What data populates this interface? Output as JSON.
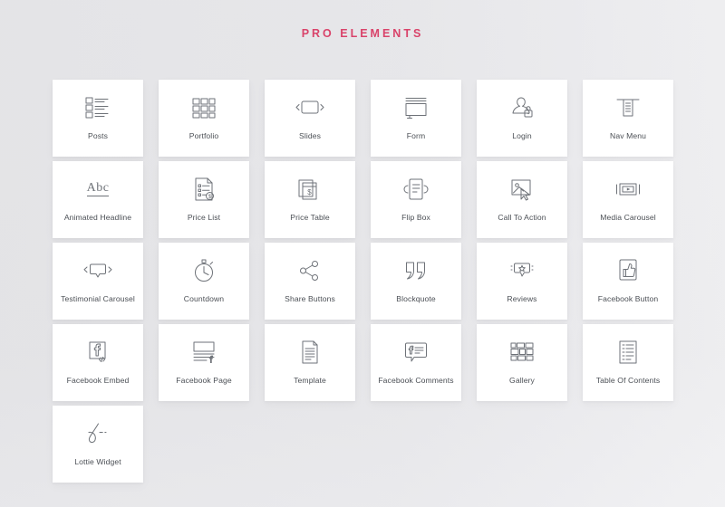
{
  "header": {
    "title": "PRO ELEMENTS",
    "title_color": "#d9436a"
  },
  "theme": {
    "background": "#f6f6f7",
    "card_background": "#ffffff",
    "icon_color": "#6e7278",
    "label_color": "#4b4f55"
  },
  "grid": {
    "columns": 6,
    "total_items": 25,
    "items": [
      {
        "label": "Posts",
        "icon": "posts-icon"
      },
      {
        "label": "Portfolio",
        "icon": "portfolio-icon"
      },
      {
        "label": "Slides",
        "icon": "slides-icon"
      },
      {
        "label": "Form",
        "icon": "form-icon"
      },
      {
        "label": "Login",
        "icon": "login-icon"
      },
      {
        "label": "Nav Menu",
        "icon": "nav-menu-icon"
      },
      {
        "label": "Animated Headline",
        "icon": "animated-headline-icon"
      },
      {
        "label": "Price List",
        "icon": "price-list-icon"
      },
      {
        "label": "Price Table",
        "icon": "price-table-icon"
      },
      {
        "label": "Flip Box",
        "icon": "flip-box-icon"
      },
      {
        "label": "Call To Action",
        "icon": "call-to-action-icon"
      },
      {
        "label": "Media Carousel",
        "icon": "media-carousel-icon"
      },
      {
        "label": "Testimonial Carousel",
        "icon": "testimonial-carousel-icon"
      },
      {
        "label": "Countdown",
        "icon": "countdown-icon"
      },
      {
        "label": "Share Buttons",
        "icon": "share-buttons-icon"
      },
      {
        "label": "Blockquote",
        "icon": "blockquote-icon"
      },
      {
        "label": "Reviews",
        "icon": "reviews-icon"
      },
      {
        "label": "Facebook Button",
        "icon": "facebook-button-icon"
      },
      {
        "label": "Facebook Embed",
        "icon": "facebook-embed-icon"
      },
      {
        "label": "Facebook Page",
        "icon": "facebook-page-icon"
      },
      {
        "label": "Template",
        "icon": "template-icon"
      },
      {
        "label": "Facebook Comments",
        "icon": "facebook-comments-icon"
      },
      {
        "label": "Gallery",
        "icon": "gallery-icon"
      },
      {
        "label": "Table Of Contents",
        "icon": "table-of-contents-icon"
      },
      {
        "label": "Lottie Widget",
        "icon": "lottie-widget-icon"
      }
    ]
  }
}
